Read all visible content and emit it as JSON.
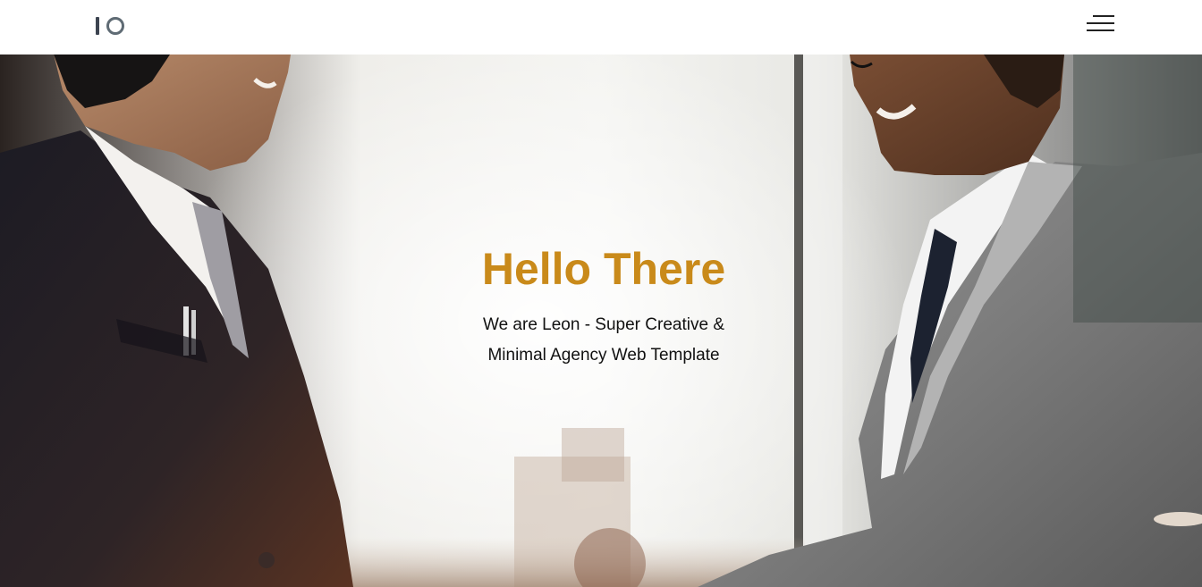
{
  "header": {
    "logo_icon": "io-logo-icon",
    "menu_icon": "hamburger-menu-icon"
  },
  "hero": {
    "title": "Hello There",
    "subtitle": "We are Leon - Super Creative & Minimal Agency Web Template",
    "accent_color": "#c98a1a",
    "background_image": "two businessmen shaking hands"
  }
}
